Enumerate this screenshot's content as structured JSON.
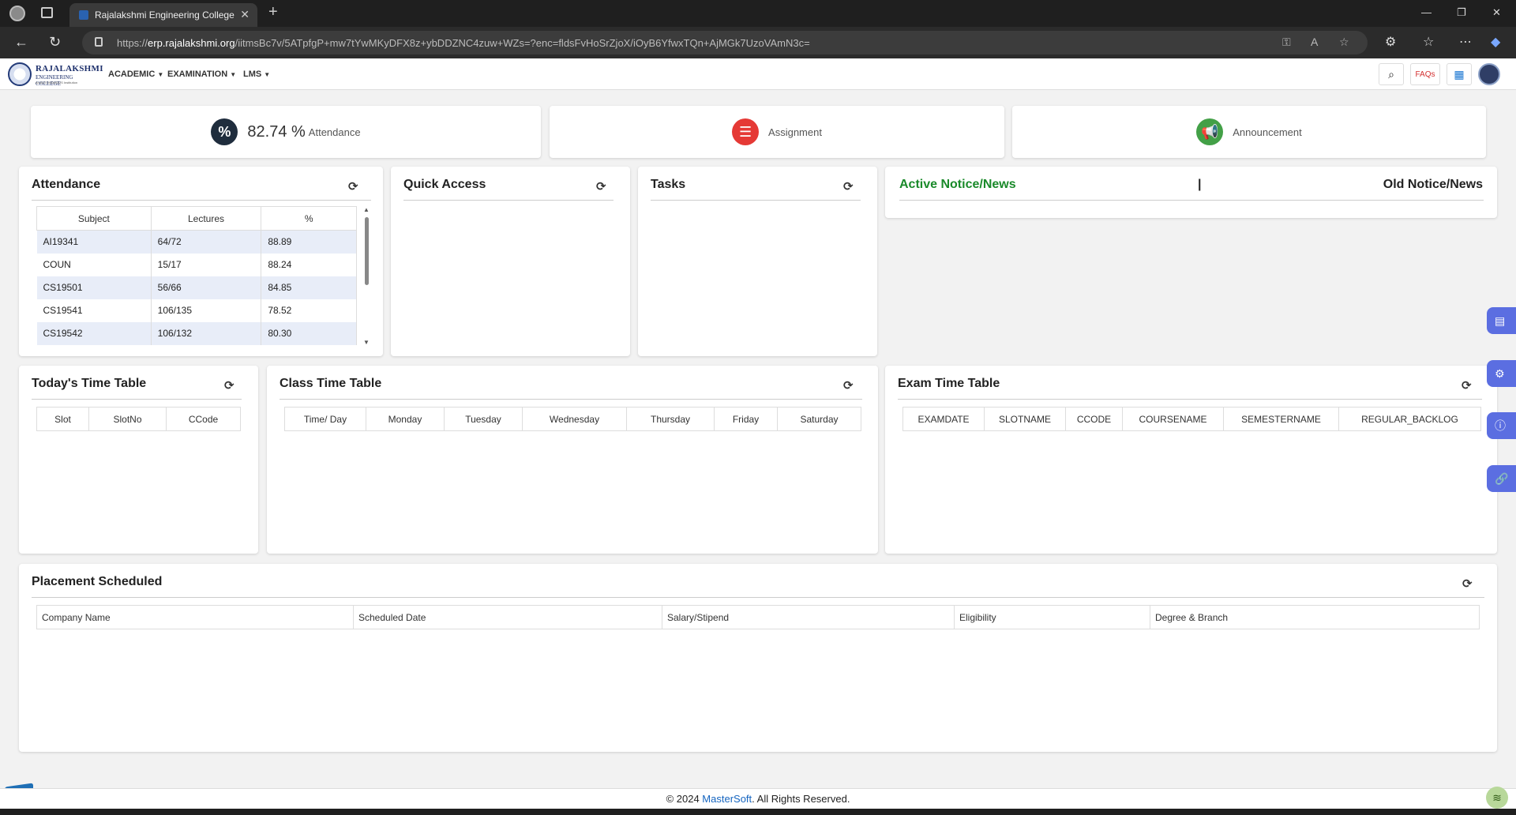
{
  "browser": {
    "tab_title": "Rajalakshmi Engineering College",
    "url_prefix": "https://",
    "url_host": "erp.rajalakshmi.org",
    "url_path": "/iitmsBc7v/5ATpfgP+mw7tYwMKyDFX8z+ybDDZNC4zuw+WZs=?enc=fldsFvHoSrZjoX/iOyB6YfwxTQn+AjMGk7UzoVAmN3c="
  },
  "header": {
    "logo_line1": "RAJALAKSHMI",
    "logo_line2": "ENGINEERING COLLEGE",
    "logo_line3": "An AUTONOMOUS Institution",
    "menus": [
      "ACADEMIC",
      "EXAMINATION",
      "LMS"
    ],
    "faq_label": "FAQs"
  },
  "stats": {
    "attendance_value": "82.74 %",
    "attendance_label": "Attendance",
    "assignment_label": "Assignment",
    "announcement_label": "Announcement"
  },
  "attendance": {
    "title": "Attendance",
    "columns": [
      "Subject",
      "Lectures",
      "%"
    ],
    "rows": [
      [
        "AI19341",
        "64/72",
        "88.89"
      ],
      [
        "COUN",
        "15/17",
        "88.24"
      ],
      [
        "CS19501",
        "56/66",
        "84.85"
      ],
      [
        "CS19541",
        "106/135",
        "78.52"
      ],
      [
        "CS19542",
        "106/132",
        "80.30"
      ]
    ]
  },
  "quick_access": {
    "title": "Quick Access"
  },
  "tasks": {
    "title": "Tasks"
  },
  "notices": {
    "active": "Active Notice/News",
    "separator": "|",
    "old": "Old Notice/News"
  },
  "todays_timetable": {
    "title": "Today's Time Table",
    "columns": [
      "Slot",
      "SlotNo",
      "CCode"
    ]
  },
  "class_timetable": {
    "title": "Class Time Table",
    "columns": [
      "Time/ Day",
      "Monday",
      "Tuesday",
      "Wednesday",
      "Thursday",
      "Friday",
      "Saturday"
    ]
  },
  "exam_timetable": {
    "title": "Exam Time Table",
    "columns": [
      "EXAMDATE",
      "SLOTNAME",
      "CCODE",
      "COURSENAME",
      "SEMESTERNAME",
      "REGULAR_BACKLOG"
    ]
  },
  "placement": {
    "title": "Placement Scheduled",
    "columns": [
      "Company Name",
      "Scheduled Date",
      "Salary/Stipend",
      "Eligibility",
      "Degree & Branch"
    ]
  },
  "footer": {
    "prefix": "© 2024 ",
    "brand": "MasterSoft",
    "suffix": ". All Rights Reserved."
  },
  "colors": {
    "notice_active": "#1a8a2a",
    "assignment_icon": "#e53935",
    "announcement_icon": "#43a047",
    "attendance_icon": "#1f2d3d",
    "side_fab": "#5b6ee1"
  }
}
